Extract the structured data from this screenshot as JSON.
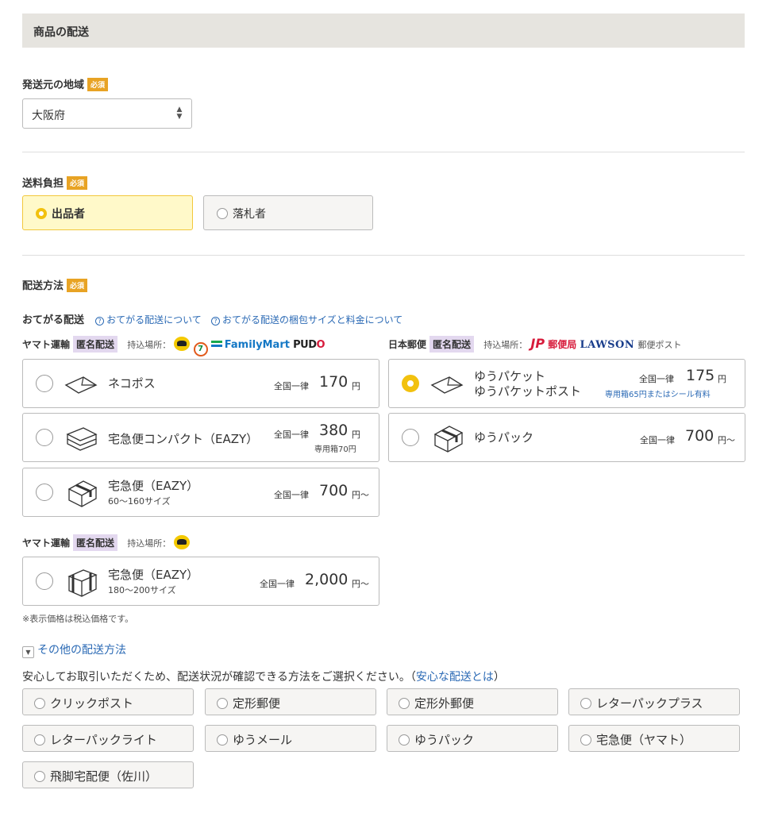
{
  "section": {
    "title": "商品の配送"
  },
  "origin": {
    "label": "発送元の地域",
    "required": "必須",
    "value": "大阪府",
    "arrows": "▲▼"
  },
  "fee": {
    "label": "送料負担",
    "required": "必須",
    "options": [
      {
        "label": "出品者",
        "selected": true
      },
      {
        "label": "落札者",
        "selected": false
      }
    ]
  },
  "method": {
    "label": "配送方法",
    "required": "必須"
  },
  "otegaru": {
    "title": "おてがる配送",
    "help_icon": "?",
    "link1": "おてがる配送について",
    "link2": "おてがる配送の梱包サイズと料金について"
  },
  "yamato": {
    "carrier": "ヤマト運輸",
    "anon": "匿名配送",
    "dropoff": "持込場所：",
    "logos": {
      "seven": "7",
      "familymart": "FamilyMart",
      "pudo_a": "PUD",
      "pudo_b": "O"
    },
    "options": [
      {
        "name": "ネコポス",
        "pre": "全国一律",
        "price": "170",
        "yen": "円"
      },
      {
        "name": "宅急便コンパクト（EAZY）",
        "pre": "全国一律",
        "price": "380",
        "yen": "円",
        "note": "専用箱70円"
      },
      {
        "name": "宅急便（EAZY）",
        "sub": "60〜160サイズ",
        "pre": "全国一律",
        "price": "700",
        "yen": "円〜"
      }
    ]
  },
  "jp": {
    "carrier": "日本郵便",
    "anon": "匿名配送",
    "dropoff": "持込場所：",
    "logos": {
      "jp": "JP",
      "yuubin": "郵便局",
      "lawson": "LAWSON",
      "post": "郵便ポスト"
    },
    "options": [
      {
        "name": "ゆうパケット",
        "name2": "ゆうパケットポスト",
        "pre": "全国一律",
        "price": "175",
        "yen": "円",
        "note": "専用箱65円またはシール有料",
        "selected": true
      },
      {
        "name": "ゆうパック",
        "pre": "全国一律",
        "price": "700",
        "yen": "円〜"
      }
    ]
  },
  "yamato2": {
    "carrier": "ヤマト運輸",
    "anon": "匿名配送",
    "dropoff": "持込場所：",
    "option": {
      "name": "宅急便（EAZY）",
      "sub": "180〜200サイズ",
      "pre": "全国一律",
      "price": "2,000",
      "yen": "円〜"
    }
  },
  "tax_note": "※表示価格は税込価格です。",
  "other": {
    "toggle_icon": "▼",
    "toggle": "その他の配送方法",
    "notice": "安心してお取引いただくため、配送状況が確認できる方法をご選択ください。（",
    "notice_link": "安心な配送とは",
    "notice_end": "）",
    "options": [
      "クリックポスト",
      "定形郵便",
      "定形外郵便",
      "レターパックプラス",
      "レターパックライト",
      "ゆうメール",
      "ゆうパック",
      "宅急便（ヤマト）",
      "飛脚宅配便（佐川）"
    ]
  }
}
